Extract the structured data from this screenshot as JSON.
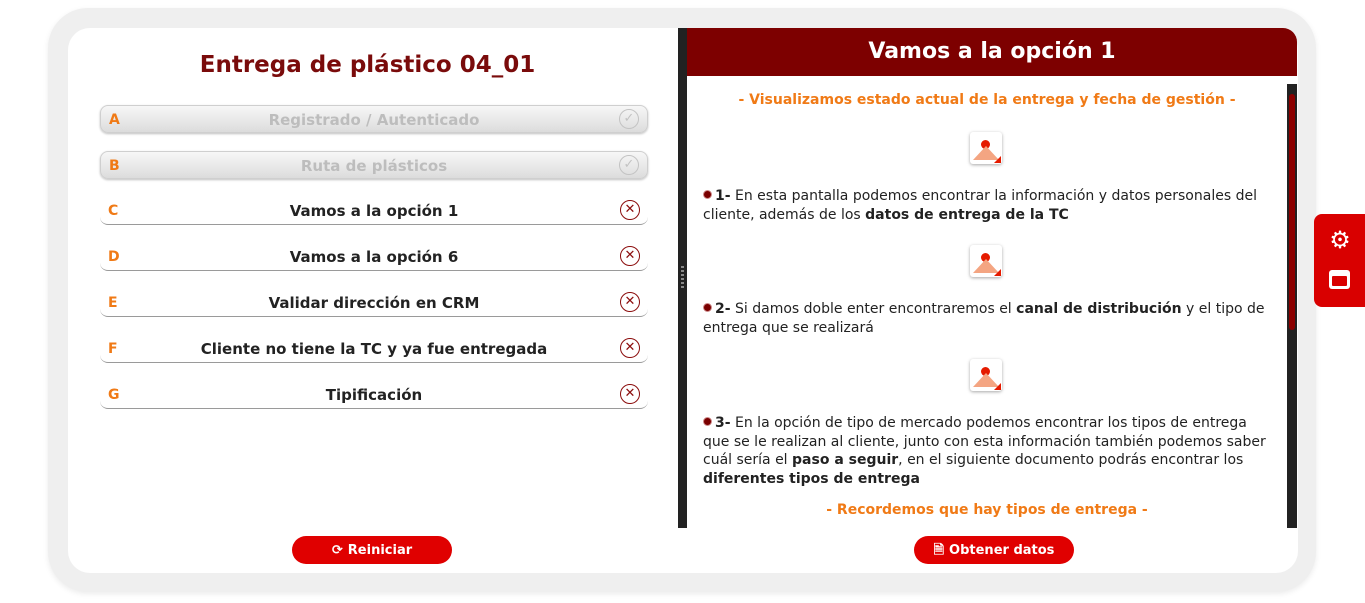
{
  "guide": {
    "title": "Entrega de plástico 04_01",
    "steps": [
      {
        "letter": "A",
        "label": "Registrado / Autenticado",
        "status": "completed"
      },
      {
        "letter": "B",
        "label": "Ruta de plásticos",
        "status": "completed"
      },
      {
        "letter": "C",
        "label": "Vamos a la opción 1",
        "status": "pending"
      },
      {
        "letter": "D",
        "label": "Vamos a la opción 6",
        "status": "pending"
      },
      {
        "letter": "E",
        "label": "Validar dirección en CRM",
        "status": "pending"
      },
      {
        "letter": "F",
        "label": "Cliente no tiene la TC y ya fue entregada",
        "status": "pending"
      },
      {
        "letter": "G",
        "label": "Tipificación",
        "status": "pending"
      }
    ],
    "check_icon": "check-circle-icon",
    "cross_icon": "x-circle-icon",
    "check_glyph": "✓",
    "cross_glyph": "✕"
  },
  "detail": {
    "title": "Vamos a la opción 1",
    "subheading_top": "- Visualizamos estado actual de la entrega y fecha de gestión -",
    "items": [
      {
        "num": "1-",
        "parts": [
          {
            "text": "En esta pantalla podemos encontrar la información y datos personales del cliente, además de los "
          },
          {
            "text": "datos de entrega de la TC",
            "bold": true
          }
        ]
      },
      {
        "num": "2-",
        "parts": [
          {
            "text": "Si damos doble enter encontraremos el "
          },
          {
            "text": "canal de distribución",
            "bold": true
          },
          {
            "text": " y el tipo de entrega que se realizará"
          }
        ]
      },
      {
        "num": "3-",
        "parts": [
          {
            "text": "En la opción de tipo de mercado podemos encontrar los tipos de entrega que se le realizan al cliente, junto con esta información también podemos saber cuál sería el "
          },
          {
            "text": "paso a seguir",
            "bold": true
          },
          {
            "text": ", en el siguiente documento podrás encontrar los "
          },
          {
            "text": "diferentes tipos de entrega",
            "bold": true
          }
        ]
      }
    ],
    "subheading_bottom": "- Recordemos que hay tipos de entrega -"
  },
  "buttons": {
    "restart_label": "Reiniciar",
    "restart_icon": "refresh-icon",
    "get_data_label": "Obtener datos",
    "get_data_icon": "document-icon"
  },
  "side_tab": {
    "settings_icon": "gear-icon",
    "panel_icon": "window-icon"
  },
  "colors": {
    "brand_dark_red": "#7d0000",
    "accent_orange": "#f07a16",
    "button_red": "#e00000"
  }
}
